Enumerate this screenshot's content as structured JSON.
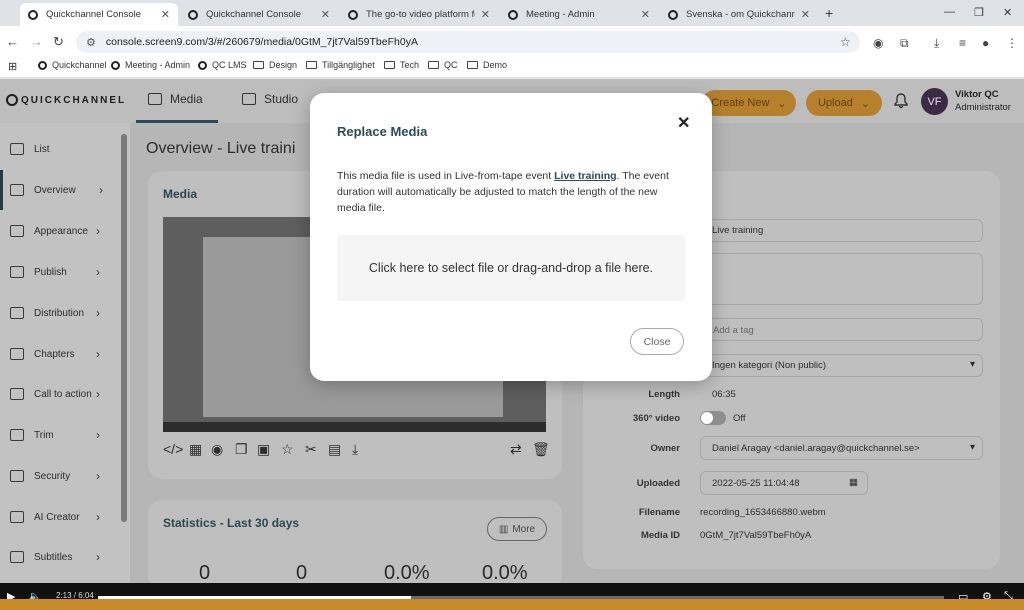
{
  "browser": {
    "tabs": [
      {
        "title": "Quickchannel Console",
        "active": true
      },
      {
        "title": "Quickchannel Console",
        "active": false
      },
      {
        "title": "The go-to video platform for p",
        "active": false
      },
      {
        "title": "Meeting - Admin",
        "active": false
      },
      {
        "title": "Svenska - om Quickchannel",
        "active": false
      }
    ],
    "new_tab": "+",
    "url": "console.screen9.com/3/#/260679/media/0GtM_7jt7Val59TbeFh0yA",
    "bookmarks": [
      "Quickchannel",
      "Meeting - Admin",
      "QC LMS",
      "Design",
      "Tillgänglighet",
      "Tech",
      "QC",
      "Demo"
    ]
  },
  "app": {
    "logo": "QUICKCHANNEL",
    "tabs": [
      "Media",
      "Studio"
    ],
    "create_new": "Create New",
    "upload": "Upload",
    "user": {
      "initials": "VF",
      "name": "Viktor QC",
      "role": "Administrator"
    }
  },
  "sidebar": {
    "items": [
      {
        "label": "List",
        "icon": "list-icon"
      },
      {
        "label": "Overview",
        "icon": "monitor-icon",
        "selected": true
      },
      {
        "label": "Appearance",
        "icon": "image-icon"
      },
      {
        "label": "Publish",
        "icon": "upload-icon"
      },
      {
        "label": "Distribution",
        "icon": "share-icon"
      },
      {
        "label": "Chapters",
        "icon": "chapters-icon"
      },
      {
        "label": "Call to action",
        "icon": "megaphone-icon"
      },
      {
        "label": "Trim",
        "icon": "scissors-icon"
      },
      {
        "label": "Security",
        "icon": "lock-icon"
      },
      {
        "label": "AI Creator",
        "icon": "ai-icon"
      },
      {
        "label": "Subtitles",
        "icon": "cc-icon"
      }
    ]
  },
  "main": {
    "title": "Overview  -  Live traini",
    "media_label": "Media",
    "stats_title": "Statistics - Last 30 days",
    "more": "More",
    "stats": [
      "0",
      "0",
      "0.0%",
      "0.0%"
    ]
  },
  "details": {
    "title_value": "Live training",
    "tag_placeholder": "Add a tag",
    "category": "Ingen kategori (Non public)",
    "length_label": "Length",
    "length": "06:35",
    "video360_label": "360° video",
    "video360": "Off",
    "owner_label": "Owner",
    "owner": "Daniel Aragay <daniel.aragay@quickchannel.se>",
    "uploaded_label": "Uploaded",
    "uploaded": "2022-05-25 11:04:48",
    "filename_label": "Filename",
    "filename": "recording_1653466880.webm",
    "mediaid_label": "Media ID",
    "mediaid": "0GtM_7jt7Val59TbeFh0yA"
  },
  "modal": {
    "title": "Replace Media",
    "text_before": "This media file is used in Live-from-tape event ",
    "link": "Live training",
    "text_after": ". The event duration will automatically be adjusted to match the length of the new media file.",
    "dropzone": "Click here to select file or drag-and-drop a file here.",
    "close": "Close"
  },
  "player": {
    "time": "2:13 / 6:04",
    "progress": 0.37
  }
}
